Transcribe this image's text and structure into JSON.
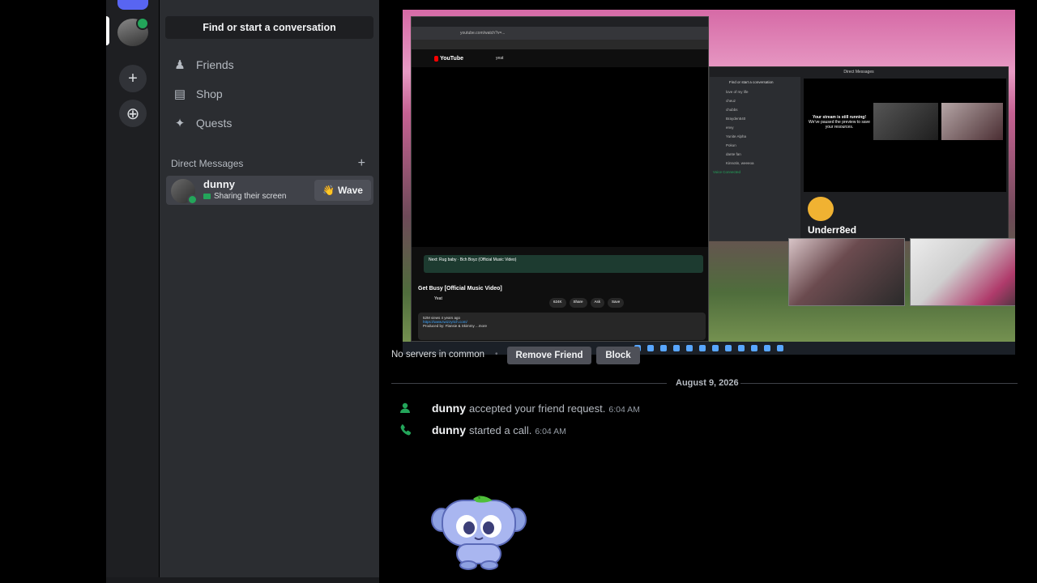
{
  "sidebar": {
    "search_label": "Find or start a conversation",
    "nav": [
      {
        "label": "Friends",
        "icon": "friends-icon"
      },
      {
        "label": "Shop",
        "icon": "shop-icon"
      },
      {
        "label": "Quests",
        "icon": "quests-icon"
      }
    ],
    "dm_header": "Direct Messages",
    "dm_add": "+",
    "dm": {
      "name": "dunny",
      "status": "Sharing their screen",
      "wave_label": "Wave",
      "wave_emoji": "👋"
    }
  },
  "rail": {
    "add_icon": "+",
    "explore_icon": "⊕"
  },
  "stream": {
    "yt_logo": "YouTube",
    "yt_search": "yeat",
    "yt_url": "youtube.com/watch?v=...",
    "yt_next": "Next: Rug baby · Bch Boyz (Official Music Video)",
    "yt_title": "Get Busy [Official Music Video]",
    "yt_channel": "Yeat",
    "yt_actions": [
      "624K",
      "Share",
      "Ask",
      "Save"
    ],
    "yt_desc": "52M views  4 years ago",
    "yt_desc_link": "https://www.twizzyrich.com/",
    "yt_produced": "Produced by: Flansie & Skimmy  ...more",
    "mini_header": "Direct Messages",
    "mini_search": "Find or start a conversation",
    "mini_stream_text": "Your stream is still running!",
    "mini_stream_sub": "We've paused the preview to save your resources.",
    "mini_bot_name": "Underr8ed",
    "mini_dms": [
      "love of my life",
      "cheuz",
      "chubbs",
      "Brayden540",
      "envy",
      "Yunite Alpha",
      "Pokun",
      "dante fan",
      "Kinnotin, weeeoa"
    ],
    "voice_connected": "Voice Connected"
  },
  "main": {
    "no_servers": "No servers in common",
    "dot": "•",
    "remove_friend": "Remove Friend",
    "block": "Block",
    "date": "August 9, 2026",
    "messages": [
      {
        "who": "dunny",
        "text": "accepted your friend request.",
        "time": "6:04 AM",
        "icon": "friend-add-icon"
      },
      {
        "who": "dunny",
        "text": "started a call.",
        "time": "6:04 AM",
        "icon": "phone-icon"
      }
    ]
  },
  "colors": {
    "background": "#000000",
    "rail": "#1e1f22",
    "sidebar": "#2b2d31",
    "selected": "#404249",
    "online": "#23a55a",
    "blurple": "#5865f2",
    "call_green": "#23a55a"
  }
}
